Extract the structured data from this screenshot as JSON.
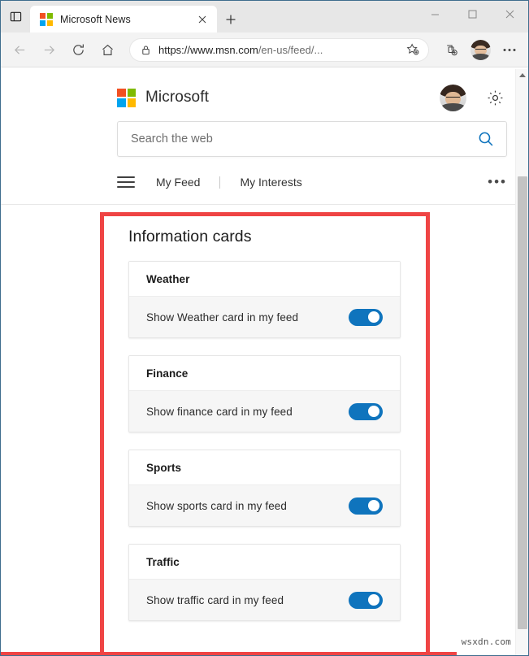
{
  "window": {
    "tab_manager_icon": "tab-manager-icon",
    "tab": {
      "title": "Microsoft News",
      "favicon": "microsoft-logo-icon",
      "close_icon": "close-icon"
    },
    "new_tab_icon": "plus-icon",
    "controls": {
      "minimize": "minimize-icon",
      "maximize": "maximize-icon",
      "close": "close-icon"
    }
  },
  "toolbar": {
    "back_icon": "back-arrow-icon",
    "forward_icon": "forward-arrow-icon",
    "refresh_icon": "refresh-icon",
    "home_icon": "home-icon",
    "lock_icon": "lock-icon",
    "url_host": "https://www.msn.com",
    "url_path": "/en-us/feed/...",
    "url_full": "https://www.msn.com/en-us/feed/...",
    "favorite_icon": "add-favorite-star-icon",
    "collections_icon": "collections-icon",
    "profile_icon": "profile-avatar-icon",
    "settings_icon": "more-options-icon"
  },
  "page": {
    "brand": {
      "logo": "microsoft-logo-icon",
      "name": "Microsoft",
      "account_avatar": "account-avatar-icon",
      "settings_icon": "gear-icon"
    },
    "search": {
      "placeholder": "Search the web",
      "value": "",
      "icon": "search-icon"
    },
    "nav": {
      "menu_icon": "hamburger-menu-icon",
      "items": [
        {
          "label": "My Feed"
        },
        {
          "label": "My Interests"
        }
      ],
      "more_label": "•••"
    },
    "section": {
      "title": "Information cards",
      "cards": [
        {
          "title": "Weather",
          "toggle_label": "Show Weather card in my feed",
          "toggle_on": true
        },
        {
          "title": "Finance",
          "toggle_label": "Show finance card in my feed",
          "toggle_on": true
        },
        {
          "title": "Sports",
          "toggle_label": "Show sports card in my feed",
          "toggle_on": true
        },
        {
          "title": "Traffic",
          "toggle_label": "Show traffic card in my feed",
          "toggle_on": true
        }
      ]
    }
  },
  "annotation": {
    "color": "#ef4444",
    "shape": "rectangle-highlight"
  },
  "colors": {
    "accent_blue": "#0f74bd",
    "toggle_on": "#0f74bd",
    "annotation_red": "#ef4444",
    "logo_red": "#f25022",
    "logo_green": "#7fba00",
    "logo_blue": "#00a4ef",
    "logo_yellow": "#ffb900"
  },
  "watermark": "wsxdn.com"
}
